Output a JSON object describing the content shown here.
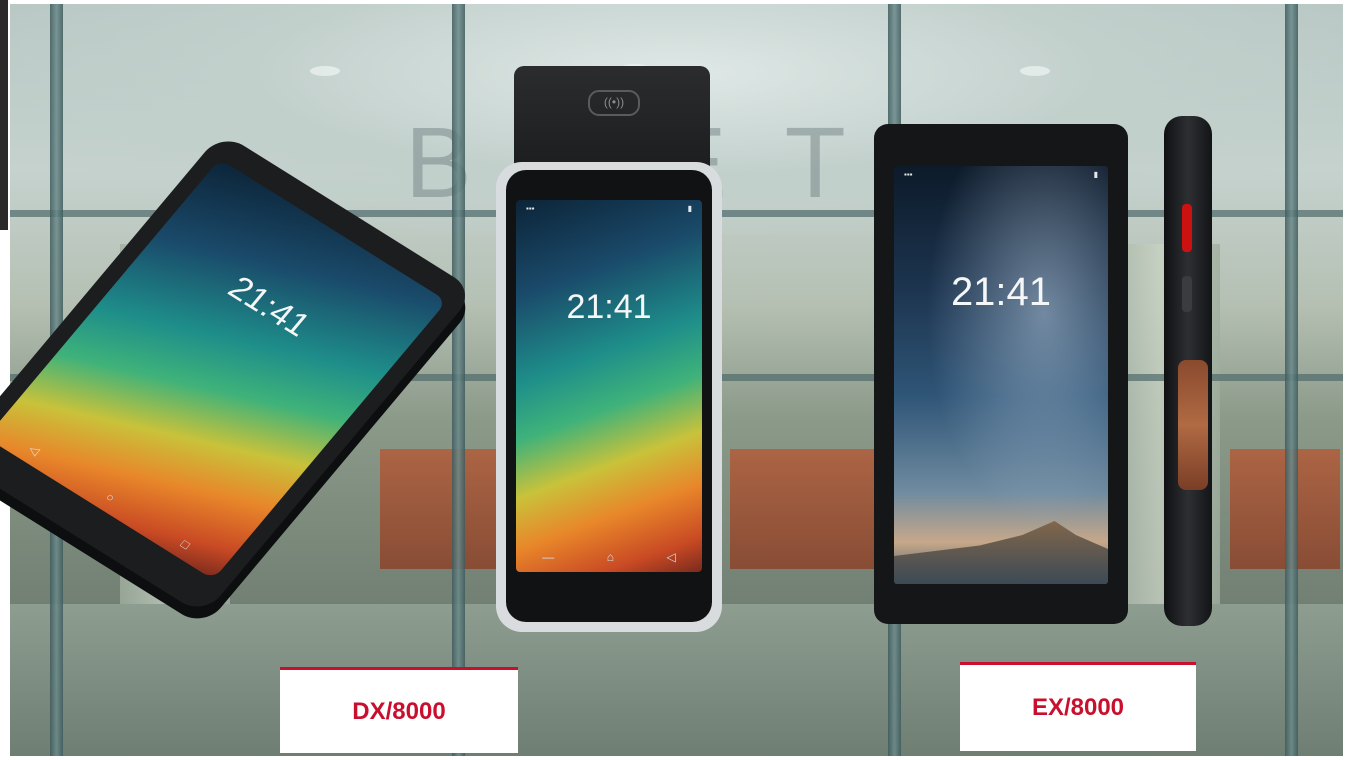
{
  "scene": {
    "background": "bank-lobby-photo",
    "accent_color": "#c8102e"
  },
  "devices": [
    {
      "clock": "21:41"
    },
    {
      "clock": "21:41"
    },
    {
      "clock": "21:41"
    }
  ],
  "labels": {
    "left": "DX/8000",
    "right": "EX/8000"
  }
}
